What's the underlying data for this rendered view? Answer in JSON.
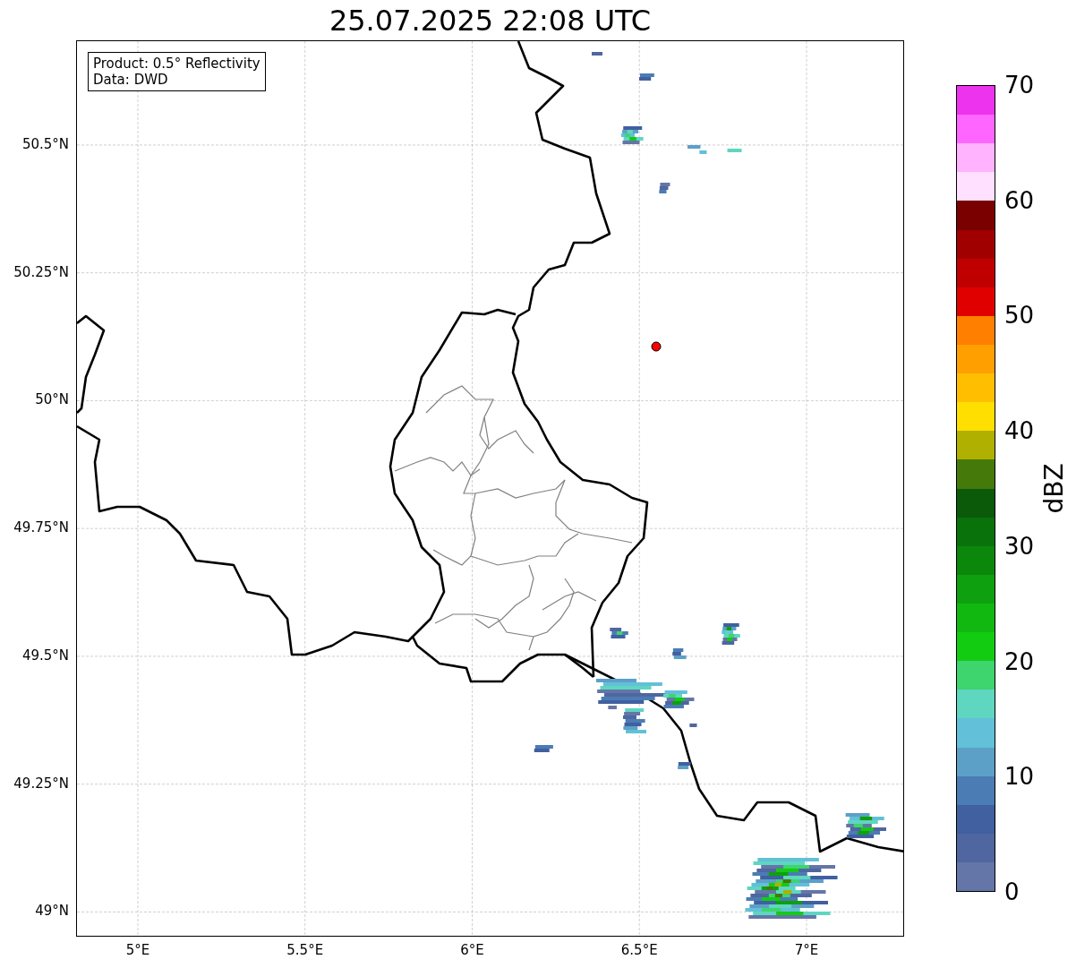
{
  "title": "25.07.2025 22:08 UTC",
  "legend": [
    "Product: 0.5° Reflectivity",
    "Data: DWD"
  ],
  "x_ticks": [
    "5°E",
    "5.5°E",
    "6°E",
    "6.5°E",
    "7°E"
  ],
  "y_ticks": [
    "50.5°N",
    "50.25°N",
    "50°N",
    "49.75°N",
    "49.5°N",
    "49.25°N",
    "49°N"
  ],
  "colorbar": {
    "label": "dBZ",
    "ticks": [
      "70",
      "60",
      "50",
      "40",
      "30",
      "20",
      "10",
      "0"
    ],
    "bins": [
      {
        "color": "#ee33ee"
      },
      {
        "color": "#ff66ff"
      },
      {
        "color": "#ffb3ff"
      },
      {
        "color": "#ffe0ff"
      },
      {
        "color": "#7a0000"
      },
      {
        "color": "#a00000"
      },
      {
        "color": "#c00000"
      },
      {
        "color": "#e00000"
      },
      {
        "color": "#ff7f00"
      },
      {
        "color": "#ff9f00"
      },
      {
        "color": "#ffbf00"
      },
      {
        "color": "#ffdf00"
      },
      {
        "color": "#b0b000"
      },
      {
        "color": "#457a0a"
      },
      {
        "color": "#0a5a0a"
      },
      {
        "color": "#0a720a"
      },
      {
        "color": "#0b870b"
      },
      {
        "color": "#0ea00e"
      },
      {
        "color": "#10b810"
      },
      {
        "color": "#12cc12"
      },
      {
        "color": "#3ed46e"
      },
      {
        "color": "#5fd6c0"
      },
      {
        "color": "#62c0d8"
      },
      {
        "color": "#5ca0c8"
      },
      {
        "color": "#4b7cb4"
      },
      {
        "color": "#4060a0"
      },
      {
        "color": "#5066a0"
      },
      {
        "color": "#6475a8"
      }
    ]
  }
}
